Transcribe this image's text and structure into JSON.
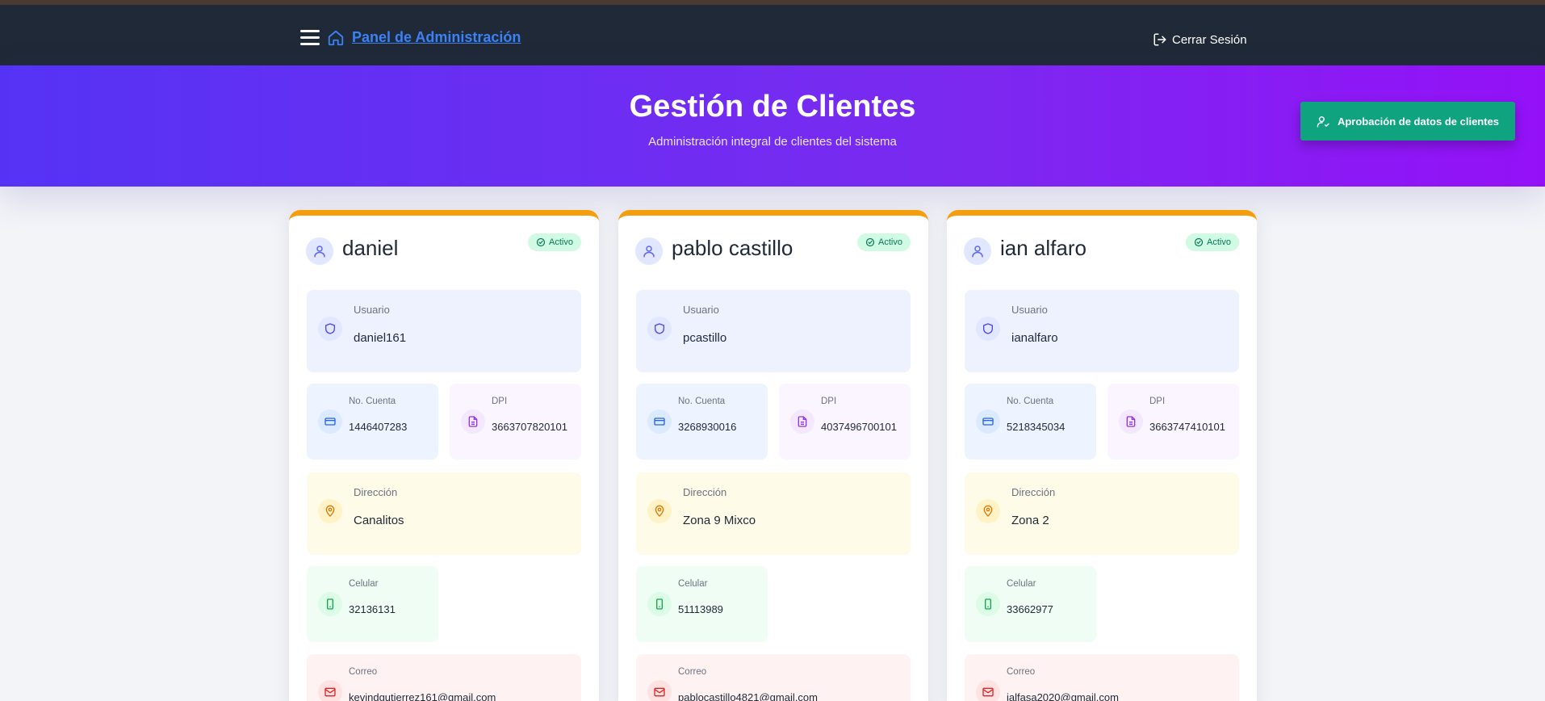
{
  "nav": {
    "brand": "Panel de Administración",
    "logout_label": "Cerrar Sesión"
  },
  "hero": {
    "title": "Gestión de Clientes",
    "subtitle": "Administración integral de clientes del sistema",
    "approve_button": "Aprobación de datos de clientes"
  },
  "labels": {
    "usuario": "Usuario",
    "cuenta": "No. Cuenta",
    "dpi": "DPI",
    "direccion": "Dirección",
    "celular": "Celular",
    "correo": "Correo"
  },
  "clients": [
    {
      "name": "daniel",
      "status": "Activo",
      "usuario": "daniel161",
      "cuenta": "1446407283",
      "dpi": "3663707820101",
      "direccion": "Canalitos",
      "celular": "32136131",
      "correo": "kevindgutierrez161@gmail.com"
    },
    {
      "name": "pablo castillo",
      "status": "Activo",
      "usuario": "pcastillo",
      "cuenta": "3268930016",
      "dpi": "4037496700101",
      "direccion": "Zona 9 Mixco",
      "celular": "51113989",
      "correo": "pablocastillo4821@gmail.com"
    },
    {
      "name": "ian alfaro",
      "status": "Activo",
      "usuario": "ianalfaro",
      "cuenta": "5218345034",
      "dpi": "3663747410101",
      "direccion": "Zona 2",
      "celular": "33662977",
      "correo": "ialfasa2020@gmail.com"
    }
  ],
  "colors": {
    "navbar": "#1f2937",
    "brand": "#3b82f6",
    "hero_start": "#5533f5",
    "hero_end": "#9411f7",
    "approve": "#10a37f",
    "card_accent": "#f59e0b",
    "badge_bg": "#d1fae5",
    "badge_text": "#047857"
  }
}
